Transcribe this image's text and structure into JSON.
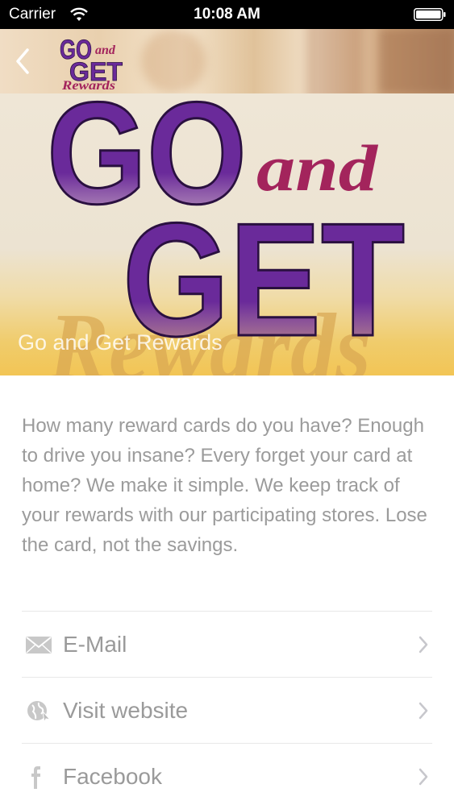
{
  "status_bar": {
    "carrier": "Carrier",
    "time": "10:08 AM"
  },
  "header": {
    "logo": {
      "line1": "GO",
      "line_and": "and",
      "line2": "GET",
      "line3": "Rewards"
    }
  },
  "hero": {
    "logo": {
      "go": "GO",
      "and": "and",
      "get": "GET",
      "rewards": "Rewards"
    },
    "caption": "Go and Get Rewards"
  },
  "description": "How many reward cards do you have? Enough to drive you insane? Every forget your card at home? We make it simple. We keep track of your rewards with our participating stores. Lose the card, not the savings.",
  "links": [
    {
      "label": "E-Mail",
      "icon": "mail-icon"
    },
    {
      "label": "Visit website",
      "icon": "globe-icon"
    },
    {
      "label": "Facebook",
      "icon": "facebook-icon"
    }
  ],
  "colors": {
    "brand_purple": "#6a2a9a",
    "brand_magenta": "#a3245c",
    "text_gray": "#9b9b9b"
  }
}
